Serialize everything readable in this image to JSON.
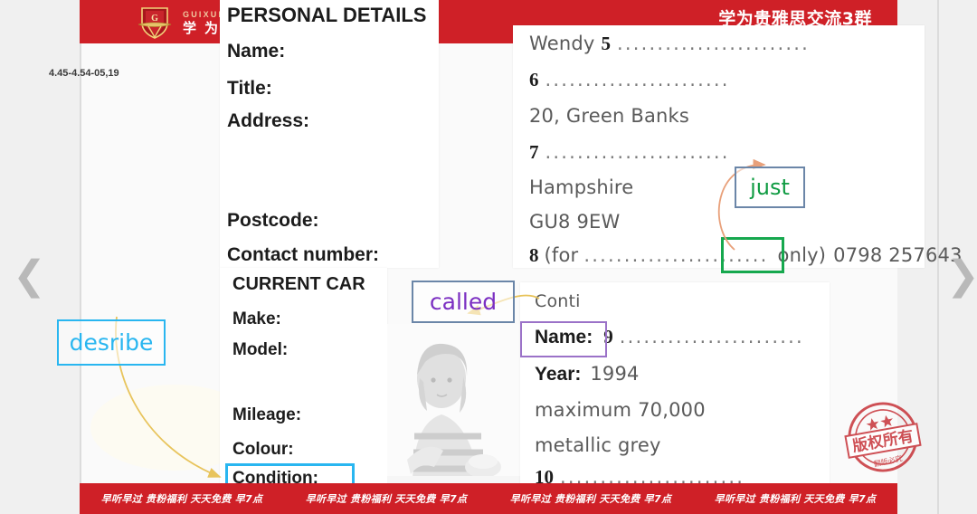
{
  "header": {
    "logo_domain": "GUIXUE.COM",
    "logo_cn": "学为贵",
    "title": "学为贵雅思交流3群"
  },
  "footer": {
    "items": [
      "早听早过  贵粉福利  天天免费  早7点",
      "早听早过  贵粉福利  天天免费  早7点",
      "早听早过  贵粉福利  天天免费  早7点",
      "早听早过  贵粉福利  天天免费  早7点"
    ]
  },
  "sidebar": {
    "timestamp": "4.45-4.54-05,19"
  },
  "nav": {
    "prev": "❮",
    "next": "❯"
  },
  "worksheet": {
    "personal_details": {
      "heading": "PERSONAL DETAILS",
      "labels": [
        "Name:",
        "Title:",
        "Address:",
        "Postcode:",
        "Contact number:"
      ]
    },
    "address_card": {
      "lines": [
        {
          "hand": "Wendy",
          "num": "5",
          "dots": "........................"
        },
        {
          "hand": "",
          "num": "6",
          "dots": "......................."
        },
        {
          "hand": "20, Green Banks",
          "num": "",
          "dots": ""
        },
        {
          "hand": "",
          "num": "7",
          "dots": "......................."
        },
        {
          "hand": "Hampshire",
          "num": "",
          "dots": ""
        },
        {
          "hand": "GU8 9EW",
          "num": "",
          "dots": ""
        }
      ],
      "contact_line": {
        "num": "8",
        "pre": "(for",
        "dots": ".......................",
        "boxed": "only)",
        "post": "0798 257643"
      }
    },
    "current_car": {
      "heading": "CURRENT CAR",
      "labels": [
        "Make:",
        "Model:",
        "Mileage:",
        "Colour:",
        "Condition:"
      ]
    },
    "conti_card": {
      "make_value": "Conti",
      "name_label": "Name:",
      "name_num": "9",
      "name_dots": ".......................",
      "year_label": "Year:",
      "year_value": "1994",
      "mileage_value": "maximum 70,000",
      "colour_value": "metallic grey",
      "condition_num": "10",
      "condition_dots": "......................."
    }
  },
  "annotations": [
    {
      "id": "desribe",
      "text": "desribe",
      "color": "#29b6f0",
      "border": "#29b6f0"
    },
    {
      "id": "called",
      "text": "called",
      "color": "#7b2fc2",
      "border": "#6b86a8"
    },
    {
      "id": "just",
      "text": "just",
      "color": "#0f9b42",
      "border": "#6b86a8"
    }
  ],
  "highlights": [
    {
      "id": "condition",
      "target": "Condition:",
      "color": "#29b6f0"
    },
    {
      "id": "only",
      "target": "only)",
      "color": "#16a84e"
    },
    {
      "id": "name9",
      "target": "Name:",
      "color": "#9b72c8"
    }
  ],
  "stamp": {
    "main": "版权所有",
    "sub": "翻版必究"
  },
  "colors": {
    "brand_red": "#cf2027",
    "cyan": "#29b6f0",
    "green": "#16a84e",
    "purple": "#7b2fc2",
    "arrow_gold": "#e8c45c",
    "arrow_salmon": "#e8a07a"
  }
}
